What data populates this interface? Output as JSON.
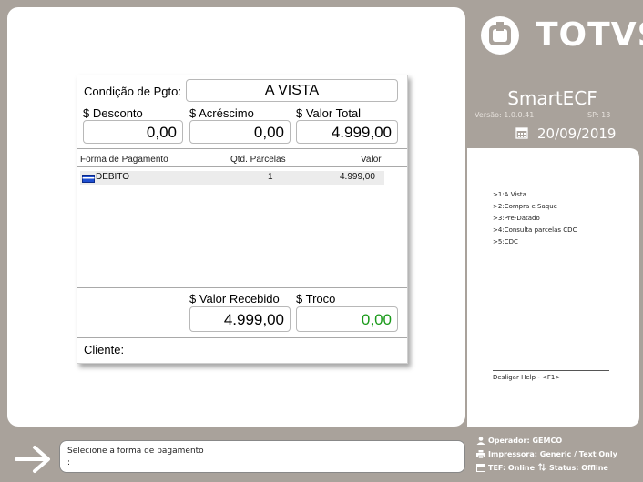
{
  "brand": {
    "logo_text": "TOTVS",
    "app_name": "SmartECF",
    "version": "Versão: 1.0.0.41",
    "sp": "SP: 13",
    "date": "20/09/2019"
  },
  "payment": {
    "condition_label": "Condição de Pgto:",
    "condition_value": "A VISTA",
    "discount_label": "$ Desconto",
    "discount_value": "0,00",
    "surcharge_label": "$ Acréscimo",
    "surcharge_value": "0,00",
    "total_label": "$ Valor Total",
    "total_value": "4.999,00",
    "table": {
      "headers": [
        "Forma de Pagamento",
        "Qtd. Parcelas",
        "Valor"
      ],
      "rows": [
        {
          "method": "DEBITO",
          "installments": "1",
          "value": "4.999,00"
        }
      ]
    },
    "received_label": "$ Valor Recebido",
    "received_value": "4.999,00",
    "change_label": "$ Troco",
    "change_value": "0,00",
    "client_label": "Cliente:"
  },
  "menu": {
    "items": [
      ">1:A Vista",
      ">2:Compra e Saque",
      ">3:Pre-Datado",
      ">4:Consulta parcelas CDC",
      ">5:CDC"
    ],
    "help": "Desligar Help - <F1>"
  },
  "message": {
    "line1": "Selecione a forma de pagamento",
    "line2": ":"
  },
  "status": {
    "operator": "Operador: GEMCO",
    "printer": "Impressora: Generic / Text Only",
    "tef": "TEF: Online",
    "status": "Status: Offline"
  },
  "colors": {
    "background": "#a9a29b",
    "change_value": "#1a9a1a",
    "card_icon": "#1f4fd1"
  }
}
